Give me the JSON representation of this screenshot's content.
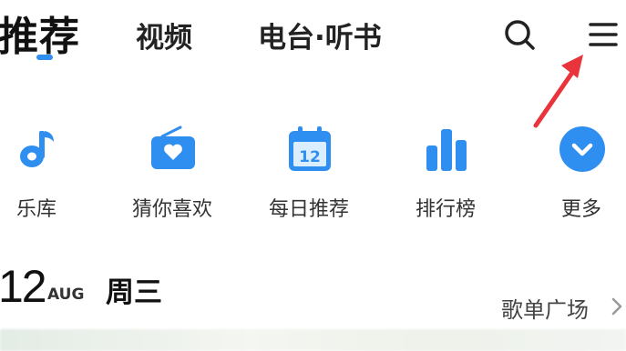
{
  "tabs": {
    "recommend": "推荐",
    "video": "视频",
    "radio": "电台·听书"
  },
  "colors": {
    "accent": "#2f8ff0",
    "arrow": "#e8343a"
  },
  "shortcuts": [
    {
      "label": "乐库",
      "icon": "music-note-icon"
    },
    {
      "label": "猜你喜欢",
      "icon": "radio-heart-icon"
    },
    {
      "label": "每日推荐",
      "icon": "calendar-icon",
      "calendar_day": "12"
    },
    {
      "label": "排行榜",
      "icon": "chart-bars-icon"
    },
    {
      "label": "更多",
      "icon": "chevron-down-circle-icon"
    }
  ],
  "date": {
    "day": "12",
    "month": "AUG",
    "weekday": "周三"
  },
  "playlist_square": "歌单广场"
}
